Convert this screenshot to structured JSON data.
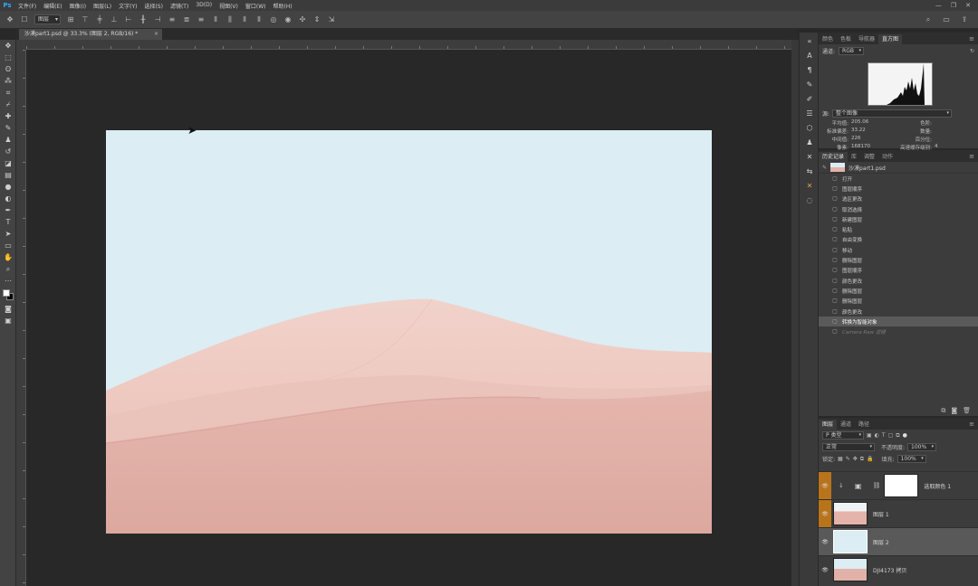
{
  "menubar": {
    "logo": "Ps",
    "items": [
      "文件(F)",
      "编辑(E)",
      "图像(I)",
      "图层(L)",
      "文字(Y)",
      "选择(S)",
      "滤镜(T)",
      "3D(D)",
      "视图(V)",
      "窗口(W)",
      "帮助(H)"
    ],
    "window_buttons": [
      "—",
      "❐",
      "✕"
    ]
  },
  "options": {
    "auto_select_value": "图层"
  },
  "document": {
    "tab_title": "沙漠part1.psd @ 33.3% (图层 2, RGB/16) *",
    "tab_close": "×"
  },
  "histogram": {
    "tabs": [
      "颜色",
      "色板",
      "导航器",
      "直方图"
    ],
    "active_tab": "直方图",
    "channel_label": "通道:",
    "channel_value": "RGB",
    "source_label": "源:",
    "source_value": "整个图像",
    "stats": [
      [
        "平均值:",
        "205.06",
        "色阶:",
        ""
      ],
      [
        "标准偏差:",
        "33.22",
        "数量:",
        ""
      ],
      [
        "中间值:",
        "226",
        "百分位:",
        ""
      ],
      [
        "像素:",
        "168170",
        "高速缓存级别:",
        "4"
      ]
    ]
  },
  "history": {
    "tabs": [
      "历史记录",
      "库",
      "调整",
      "动作"
    ],
    "active_tab": "历史记录",
    "snapshot": "沙漠part1.psd",
    "items": [
      {
        "label": "打开",
        "state": "normal"
      },
      {
        "label": "图层顺序",
        "state": "normal"
      },
      {
        "label": "选区更改",
        "state": "normal"
      },
      {
        "label": "取消选择",
        "state": "normal"
      },
      {
        "label": "新建图层",
        "state": "normal"
      },
      {
        "label": "粘贴",
        "state": "normal"
      },
      {
        "label": "自由变换",
        "state": "normal"
      },
      {
        "label": "移动",
        "state": "normal"
      },
      {
        "label": "删除图层",
        "state": "normal"
      },
      {
        "label": "图层顺序",
        "state": "normal"
      },
      {
        "label": "颜色更改",
        "state": "normal"
      },
      {
        "label": "删除图层",
        "state": "normal"
      },
      {
        "label": "删除图层",
        "state": "normal"
      },
      {
        "label": "颜色更改",
        "state": "normal"
      },
      {
        "label": "转换为智能对象",
        "state": "selected"
      },
      {
        "label": "Camera Raw 滤镜",
        "state": "dim"
      }
    ]
  },
  "layers": {
    "tabs": [
      "图层",
      "通道",
      "路径"
    ],
    "active_tab": "图层",
    "filter_label": "P 类型",
    "blend_mode": "正常",
    "opacity_label": "不透明度:",
    "opacity_value": "100%",
    "lock_label": "锁定:",
    "fill_label": "填充:",
    "fill_value": "100%",
    "items": [
      {
        "name": "选取颜色 1",
        "kind": "adjustment"
      },
      {
        "name": "图层 1",
        "kind": "pixel"
      },
      {
        "name": "图层 2",
        "kind": "pixel",
        "selected": true
      },
      {
        "name": "DJI4173 拷贝",
        "kind": "smart"
      }
    ]
  },
  "colors": {
    "sky": "#dcedf4",
    "dune_light": "#efcbc3",
    "dune_mid": "#e4b4ab",
    "dune_dark": "#d9a59c",
    "accent_orange": "#b8741a"
  }
}
